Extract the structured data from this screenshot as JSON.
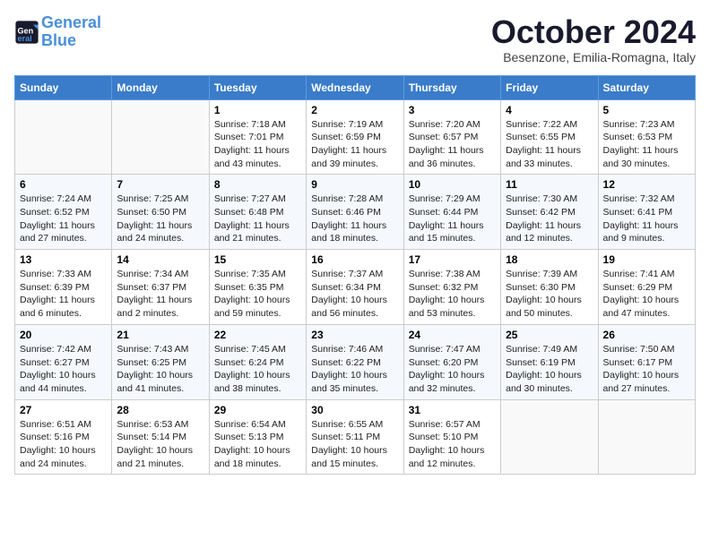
{
  "logo": {
    "line1": "General",
    "line2": "Blue"
  },
  "title": "October 2024",
  "subtitle": "Besenzone, Emilia-Romagna, Italy",
  "days_of_week": [
    "Sunday",
    "Monday",
    "Tuesday",
    "Wednesday",
    "Thursday",
    "Friday",
    "Saturday"
  ],
  "weeks": [
    [
      null,
      null,
      {
        "day": 1,
        "sunrise": "7:18 AM",
        "sunset": "7:01 PM",
        "daylight": "11 hours and 43 minutes."
      },
      {
        "day": 2,
        "sunrise": "7:19 AM",
        "sunset": "6:59 PM",
        "daylight": "11 hours and 39 minutes."
      },
      {
        "day": 3,
        "sunrise": "7:20 AM",
        "sunset": "6:57 PM",
        "daylight": "11 hours and 36 minutes."
      },
      {
        "day": 4,
        "sunrise": "7:22 AM",
        "sunset": "6:55 PM",
        "daylight": "11 hours and 33 minutes."
      },
      {
        "day": 5,
        "sunrise": "7:23 AM",
        "sunset": "6:53 PM",
        "daylight": "11 hours and 30 minutes."
      }
    ],
    [
      {
        "day": 6,
        "sunrise": "7:24 AM",
        "sunset": "6:52 PM",
        "daylight": "11 hours and 27 minutes."
      },
      {
        "day": 7,
        "sunrise": "7:25 AM",
        "sunset": "6:50 PM",
        "daylight": "11 hours and 24 minutes."
      },
      {
        "day": 8,
        "sunrise": "7:27 AM",
        "sunset": "6:48 PM",
        "daylight": "11 hours and 21 minutes."
      },
      {
        "day": 9,
        "sunrise": "7:28 AM",
        "sunset": "6:46 PM",
        "daylight": "11 hours and 18 minutes."
      },
      {
        "day": 10,
        "sunrise": "7:29 AM",
        "sunset": "6:44 PM",
        "daylight": "11 hours and 15 minutes."
      },
      {
        "day": 11,
        "sunrise": "7:30 AM",
        "sunset": "6:42 PM",
        "daylight": "11 hours and 12 minutes."
      },
      {
        "day": 12,
        "sunrise": "7:32 AM",
        "sunset": "6:41 PM",
        "daylight": "11 hours and 9 minutes."
      }
    ],
    [
      {
        "day": 13,
        "sunrise": "7:33 AM",
        "sunset": "6:39 PM",
        "daylight": "11 hours and 6 minutes."
      },
      {
        "day": 14,
        "sunrise": "7:34 AM",
        "sunset": "6:37 PM",
        "daylight": "11 hours and 2 minutes."
      },
      {
        "day": 15,
        "sunrise": "7:35 AM",
        "sunset": "6:35 PM",
        "daylight": "10 hours and 59 minutes."
      },
      {
        "day": 16,
        "sunrise": "7:37 AM",
        "sunset": "6:34 PM",
        "daylight": "10 hours and 56 minutes."
      },
      {
        "day": 17,
        "sunrise": "7:38 AM",
        "sunset": "6:32 PM",
        "daylight": "10 hours and 53 minutes."
      },
      {
        "day": 18,
        "sunrise": "7:39 AM",
        "sunset": "6:30 PM",
        "daylight": "10 hours and 50 minutes."
      },
      {
        "day": 19,
        "sunrise": "7:41 AM",
        "sunset": "6:29 PM",
        "daylight": "10 hours and 47 minutes."
      }
    ],
    [
      {
        "day": 20,
        "sunrise": "7:42 AM",
        "sunset": "6:27 PM",
        "daylight": "10 hours and 44 minutes."
      },
      {
        "day": 21,
        "sunrise": "7:43 AM",
        "sunset": "6:25 PM",
        "daylight": "10 hours and 41 minutes."
      },
      {
        "day": 22,
        "sunrise": "7:45 AM",
        "sunset": "6:24 PM",
        "daylight": "10 hours and 38 minutes."
      },
      {
        "day": 23,
        "sunrise": "7:46 AM",
        "sunset": "6:22 PM",
        "daylight": "10 hours and 35 minutes."
      },
      {
        "day": 24,
        "sunrise": "7:47 AM",
        "sunset": "6:20 PM",
        "daylight": "10 hours and 32 minutes."
      },
      {
        "day": 25,
        "sunrise": "7:49 AM",
        "sunset": "6:19 PM",
        "daylight": "10 hours and 30 minutes."
      },
      {
        "day": 26,
        "sunrise": "7:50 AM",
        "sunset": "6:17 PM",
        "daylight": "10 hours and 27 minutes."
      }
    ],
    [
      {
        "day": 27,
        "sunrise": "6:51 AM",
        "sunset": "5:16 PM",
        "daylight": "10 hours and 24 minutes."
      },
      {
        "day": 28,
        "sunrise": "6:53 AM",
        "sunset": "5:14 PM",
        "daylight": "10 hours and 21 minutes."
      },
      {
        "day": 29,
        "sunrise": "6:54 AM",
        "sunset": "5:13 PM",
        "daylight": "10 hours and 18 minutes."
      },
      {
        "day": 30,
        "sunrise": "6:55 AM",
        "sunset": "5:11 PM",
        "daylight": "10 hours and 15 minutes."
      },
      {
        "day": 31,
        "sunrise": "6:57 AM",
        "sunset": "5:10 PM",
        "daylight": "10 hours and 12 minutes."
      },
      null,
      null
    ]
  ],
  "labels": {
    "sunrise": "Sunrise:",
    "sunset": "Sunset:",
    "daylight": "Daylight:"
  }
}
